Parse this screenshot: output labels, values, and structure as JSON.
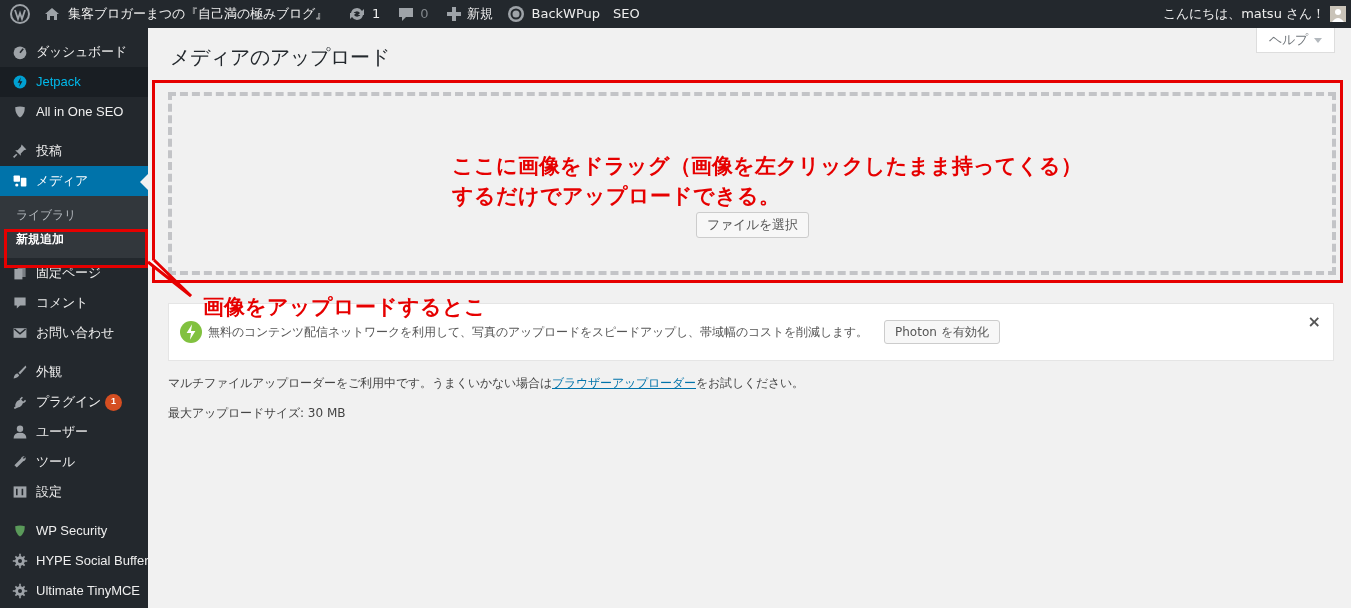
{
  "admin_bar": {
    "site_name": "集客ブロガーまつの『自己満の極みブログ』",
    "updates": "1",
    "comments": "0",
    "new": "新規",
    "backwpup": "BackWPup",
    "seo": "SEO",
    "greeting": "こんにちは、matsu さん！"
  },
  "sidebar": {
    "groups": [
      [
        {
          "label": "ダッシュボード",
          "selected": false,
          "highlighted": false
        },
        {
          "label": "Jetpack",
          "selected": false,
          "highlighted": true
        },
        {
          "label": "All in One SEO",
          "selected": false,
          "highlighted": false
        }
      ],
      [
        {
          "label": "投稿",
          "selected": false,
          "highlighted": false
        },
        {
          "label": "メディア",
          "selected": true,
          "highlighted": false,
          "children": [
            {
              "label": "ライブラリ",
              "selected": false
            },
            {
              "label": "新規追加",
              "selected": true
            }
          ]
        },
        {
          "label": "固定ページ",
          "selected": false,
          "highlighted": false
        },
        {
          "label": "コメント",
          "selected": false,
          "highlighted": false
        },
        {
          "label": "お問い合わせ",
          "selected": false,
          "highlighted": false
        }
      ],
      [
        {
          "label": "外観",
          "selected": false,
          "highlighted": false
        },
        {
          "label": "プラグイン",
          "selected": false,
          "highlighted": false,
          "badge": "1"
        },
        {
          "label": "ユーザー",
          "selected": false,
          "highlighted": false
        },
        {
          "label": "ツール",
          "selected": false,
          "highlighted": false
        },
        {
          "label": "設定",
          "selected": false,
          "highlighted": false
        }
      ],
      [
        {
          "label": "WP Security",
          "selected": false,
          "highlighted": false
        },
        {
          "label": "HYPE Social Buffer",
          "selected": false,
          "highlighted": false
        },
        {
          "label": "Ultimate TinyMCE",
          "selected": false,
          "highlighted": false
        }
      ]
    ]
  },
  "help_tab": "ヘルプ",
  "page_title": "メディアのアップロード",
  "uploader": {
    "button": "ファイルを選択"
  },
  "notice": {
    "message": "無料のコンテンツ配信ネットワークを利用して、写真のアップロードをスピードアップし、帯域幅のコストを削減します。",
    "button": "Photon を有効化",
    "close": "×"
  },
  "info": {
    "text_before": "マルチファイルアップローダーをご利用中です。うまくいかない場合は",
    "link": "ブラウザーアップローダー",
    "text_after": "をお試しください。"
  },
  "max_size": "最大アップロードサイズ: 30 MB",
  "annotations": [
    {
      "kind": "dropzone",
      "lines": [
        "ここに画像をドラッグ（画像を左クリックしたまま持ってくる）",
        "するだけでアップロードできる。"
      ]
    },
    {
      "kind": "submenu",
      "lines": [
        "画像をアップロードするとこ"
      ]
    }
  ]
}
